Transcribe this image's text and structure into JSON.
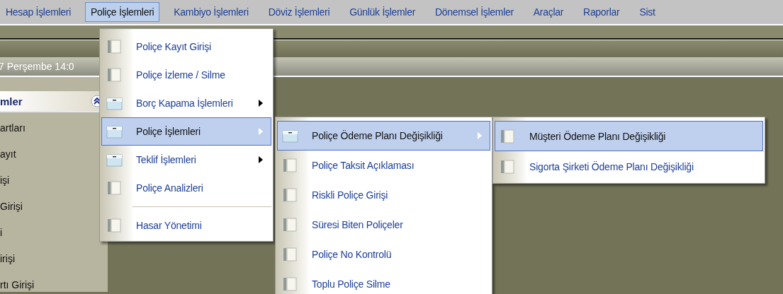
{
  "menu_bar": [
    {
      "label": "Hesap İşlemleri",
      "selected": false
    },
    {
      "label": "Poliçe İşlemleri",
      "selected": true
    },
    {
      "label": "Kambiyo İşlemleri",
      "selected": false
    },
    {
      "label": "Döviz İşlemleri",
      "selected": false
    },
    {
      "label": "Günlük İşlemler",
      "selected": false
    },
    {
      "label": "Dönemsel İşlemler",
      "selected": false
    },
    {
      "label": "Araçlar",
      "selected": false
    },
    {
      "label": "Raporlar",
      "selected": false
    },
    {
      "label": "Sist",
      "selected": false
    }
  ],
  "date_bar": {
    "text": "7 Perşembe 14:0"
  },
  "sidebar": {
    "title": "mler",
    "items": [
      "artları",
      "ayıt",
      "işi",
      "Girişi",
      "i",
      "irişi",
      "rtı Girişi"
    ]
  },
  "menus": [
    {
      "items": [
        {
          "kind": "command",
          "label": "Poliçe Kayıt Girişi",
          "selected": false
        },
        {
          "kind": "command",
          "label": "Poliçe İzleme / Silme",
          "selected": false
        },
        {
          "kind": "submenu",
          "label": "Borç Kapama İşlemleri",
          "selected": false
        },
        {
          "kind": "submenu",
          "label": "Poliçe İşlemleri",
          "selected": true
        },
        {
          "kind": "submenu",
          "label": "Teklif İşlemleri",
          "selected": false
        },
        {
          "kind": "command",
          "label": "Poliçe Analizleri",
          "selected": false
        },
        {
          "kind": "separator"
        },
        {
          "kind": "command",
          "label": "Hasar Yönetimi",
          "selected": false
        }
      ]
    },
    {
      "items": [
        {
          "kind": "submenu",
          "label": "Poliçe Ödeme Planı Değişikliği",
          "selected": true
        },
        {
          "kind": "command",
          "label": "Poliçe Taksit Açıklaması",
          "selected": false
        },
        {
          "kind": "command",
          "label": "Riskli Poliçe Girişi",
          "selected": false
        },
        {
          "kind": "command",
          "label": "Süresi Biten Poliçeler",
          "selected": false
        },
        {
          "kind": "command",
          "label": "Poliçe No Kontrolü",
          "selected": false
        },
        {
          "kind": "command",
          "label": "Toplu Poliçe Silme",
          "selected": false
        }
      ]
    },
    {
      "items": [
        {
          "kind": "command",
          "label": "Müşteri Ödeme Planı Değişikliği",
          "selected": true
        },
        {
          "kind": "command",
          "label": "Sigorta Şirketi Ödeme Planı Değişikliği",
          "selected": false
        }
      ]
    }
  ]
}
